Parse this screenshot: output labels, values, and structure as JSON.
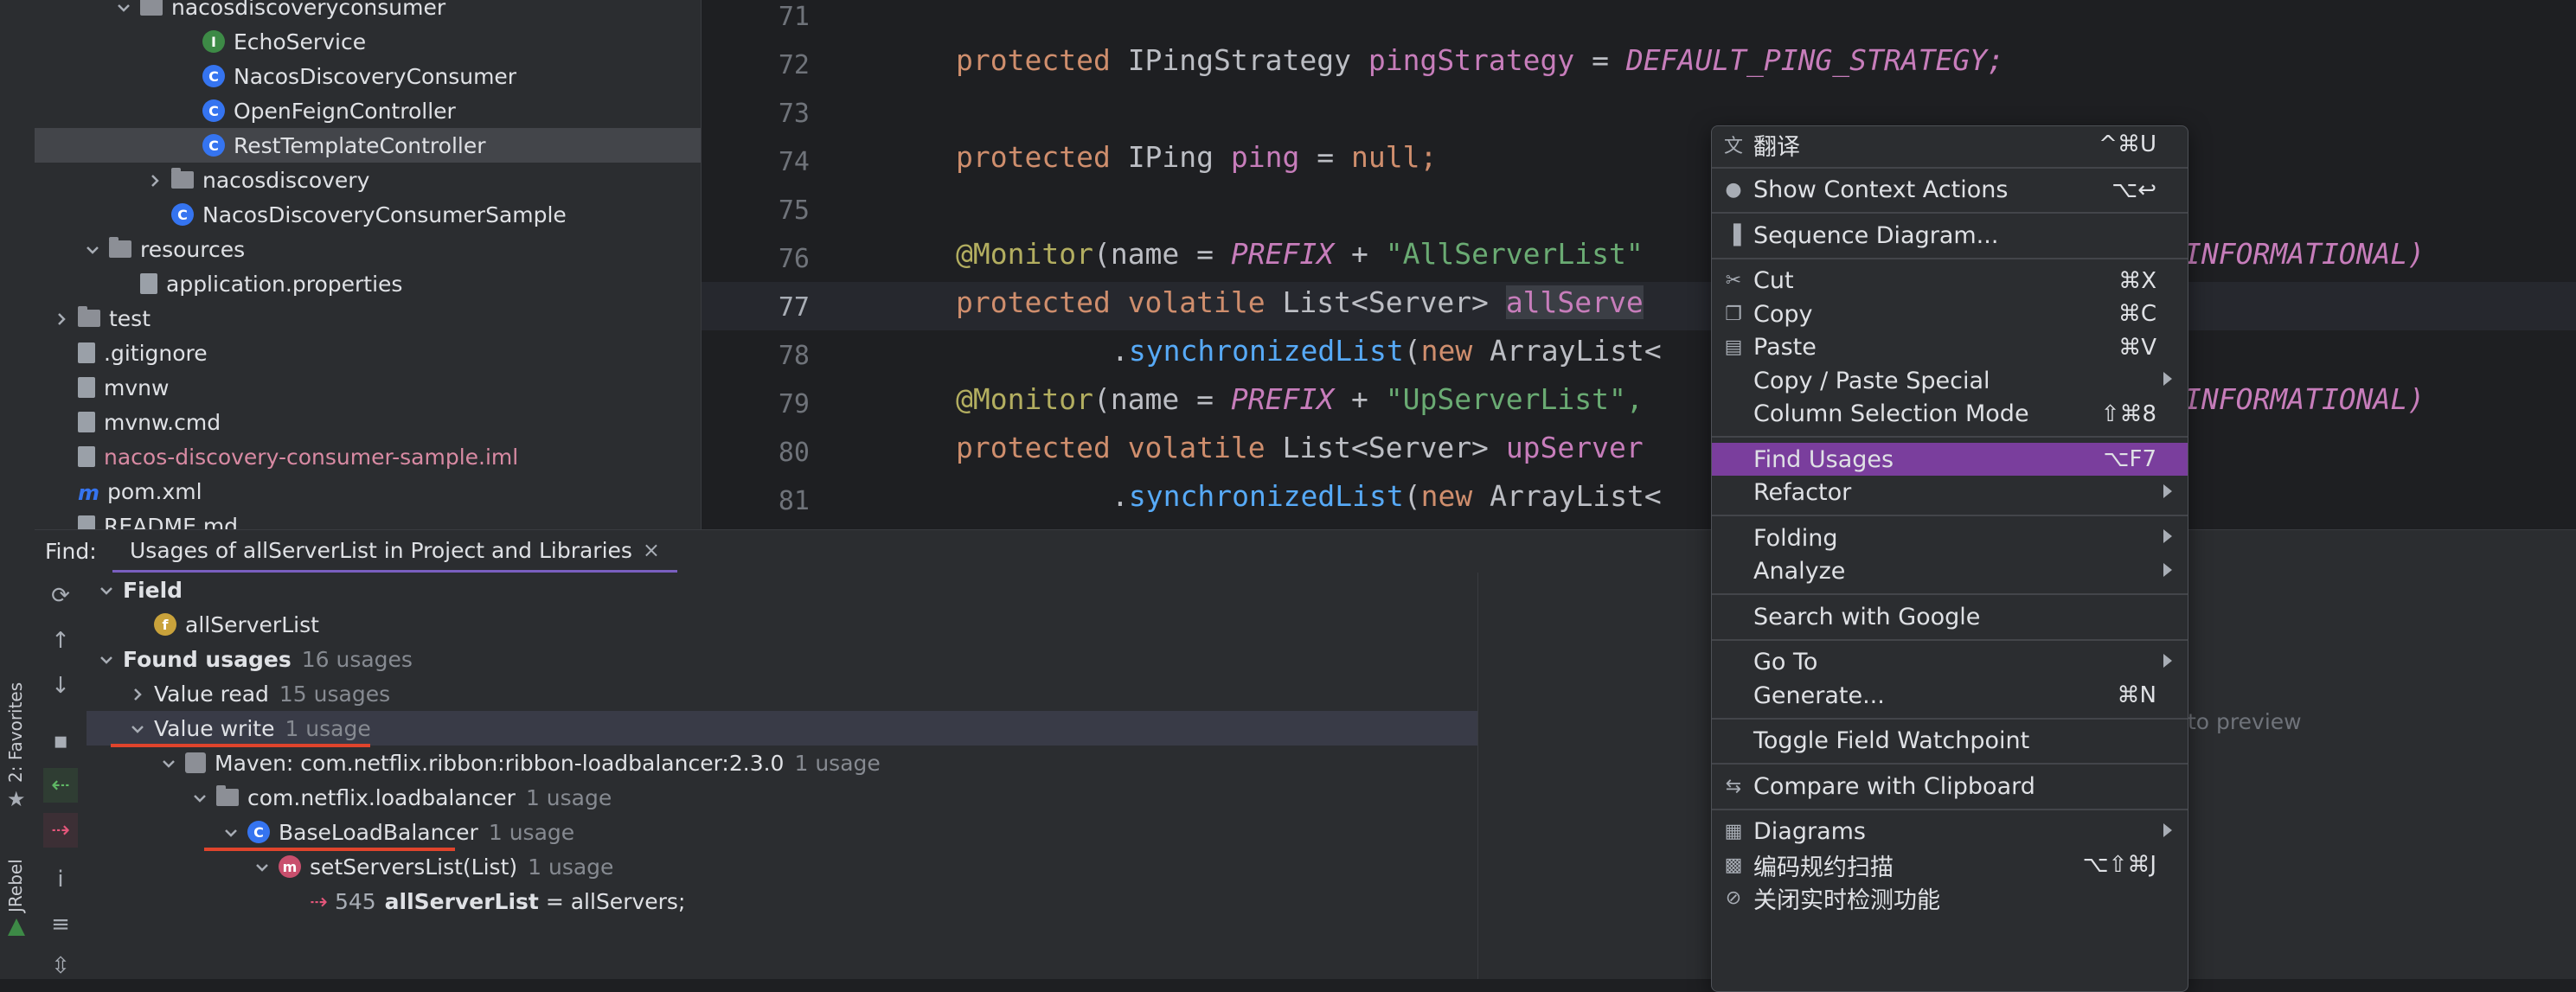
{
  "leftbar": {
    "favorites": "2: Favorites",
    "jrebel": "JRebel"
  },
  "project_tree": [
    {
      "label": "nacosdiscoveryconsumer",
      "kind": "folder",
      "indent": 2,
      "expanded": true
    },
    {
      "label": "EchoService",
      "kind": "interface",
      "indent": 4
    },
    {
      "label": "NacosDiscoveryConsumer",
      "kind": "class",
      "indent": 4
    },
    {
      "label": "OpenFeignController",
      "kind": "class",
      "indent": 4
    },
    {
      "label": "RestTemplateController",
      "kind": "class",
      "indent": 4,
      "selected": true
    },
    {
      "label": "nacosdiscovery",
      "kind": "folder",
      "indent": 3,
      "expanded": false
    },
    {
      "label": "NacosDiscoveryConsumerSample",
      "kind": "class",
      "indent": 3
    },
    {
      "label": "resources",
      "kind": "folder",
      "indent": 1,
      "expanded": true
    },
    {
      "label": "application.properties",
      "kind": "file",
      "indent": 2
    },
    {
      "label": "test",
      "kind": "folder",
      "indent": 0,
      "expanded": false
    },
    {
      "label": ".gitignore",
      "kind": "file",
      "indent": 0
    },
    {
      "label": "mvnw",
      "kind": "file",
      "indent": 0
    },
    {
      "label": "mvnw.cmd",
      "kind": "file",
      "indent": 0
    },
    {
      "label": "nacos-discovery-consumer-sample.iml",
      "kind": "file",
      "indent": 0,
      "accent": "#d88aa3"
    },
    {
      "label": "pom.xml",
      "kind": "maven",
      "indent": 0
    },
    {
      "label": "README.md",
      "kind": "file",
      "indent": 0
    }
  ],
  "editor": {
    "line_numbers": [
      "71",
      "72",
      "73",
      "74",
      "75",
      "76",
      "77",
      "78",
      "79",
      "80",
      "81"
    ],
    "lines": {
      "l72": [
        "protected",
        "IPingStrategy",
        "pingStrategy",
        "=",
        "DEFAULT_PING_STRATEGY;"
      ],
      "l74": [
        "protected",
        "IPing",
        "ping",
        "=",
        "null;"
      ],
      "l76a": "@Monitor",
      "l76b": "(name = ",
      "l76c": "PREFIX",
      "l76d": " + ",
      "l76e": "\"AllServerList\"",
      "l76tail": "INFORMATIONAL)",
      "l77": [
        "protected",
        "volatile",
        "List<Server>",
        "allServe"
      ],
      "l78a": ".",
      "l78b": "synchronizedList",
      "l78c": "(",
      "l78d": "new",
      "l78e": " ArrayList<",
      "l79a": "@Monitor",
      "l79b": "(name = ",
      "l79c": "PREFIX",
      "l79d": " + ",
      "l79e": "\"UpServerList\",",
      "l79tail": "INFORMATIONAL)",
      "l80": [
        "protected",
        "volatile",
        "List<Server>",
        "upServer"
      ],
      "l81a": ".",
      "l81b": "synchronizedList",
      "l81c": "(",
      "l81d": "new",
      "l81e": " ArrayList<"
    }
  },
  "find": {
    "label": "Find:",
    "tab_title": "Usages of allServerList in Project and Libraries",
    "close": "×",
    "preview_hint": "to preview",
    "tree": [
      {
        "label": "Field",
        "count": "",
        "bold": true,
        "depth": 0,
        "chev": "down"
      },
      {
        "label": "allServerList",
        "count": "",
        "depth": 1,
        "chev": "none",
        "icon": "field"
      },
      {
        "label": "Found usages",
        "count": "16 usages",
        "bold": true,
        "depth": 0,
        "chev": "down"
      },
      {
        "label": "Value read",
        "count": "15 usages",
        "depth": 1,
        "chev": "right"
      },
      {
        "label": "Value write",
        "count": "1 usage",
        "depth": 1,
        "chev": "down",
        "selected": true,
        "underline": true
      },
      {
        "label": "Maven: com.netflix.ribbon:ribbon-loadbalancer:2.3.0",
        "count": "1 usage",
        "depth": 2,
        "chev": "down",
        "icon": "lib"
      },
      {
        "label": "com.netflix.loadbalancer",
        "count": "1 usage",
        "depth": 3,
        "chev": "down",
        "icon": "pkg"
      },
      {
        "label": "BaseLoadBalancer",
        "count": "1 usage",
        "depth": 4,
        "chev": "down",
        "icon": "class",
        "underline": true
      },
      {
        "label": "setServersList(List)",
        "count": "1 usage",
        "depth": 5,
        "chev": "down",
        "icon": "method"
      },
      {
        "label": "545",
        "count": "",
        "depth": 6,
        "chev": "none",
        "icon": "write",
        "code": "allServerList",
        "rest": " = allServers;"
      }
    ]
  },
  "context_menu": {
    "items": [
      {
        "type": "item",
        "label": "翻译",
        "shortcut": "^⌘U",
        "icon": "translate-icon",
        "glyph": "文"
      },
      {
        "type": "sep"
      },
      {
        "type": "item",
        "label": "Show Context Actions",
        "shortcut": "⌥↩",
        "icon": "bulb-icon",
        "glyph": "●"
      },
      {
        "type": "sep"
      },
      {
        "type": "item",
        "label": "Sequence Diagram...",
        "shortcut": "",
        "icon": "sequence-diagram-icon",
        "glyph": "▐"
      },
      {
        "type": "sep"
      },
      {
        "type": "item",
        "label": "Cut",
        "shortcut": "⌘X",
        "icon": "scissors-icon",
        "glyph": "✂"
      },
      {
        "type": "item",
        "label": "Copy",
        "shortcut": "⌘C",
        "icon": "copy-icon",
        "glyph": "❐"
      },
      {
        "type": "item",
        "label": "Paste",
        "shortcut": "⌘V",
        "icon": "paste-icon",
        "glyph": "▤"
      },
      {
        "type": "item",
        "label": "Copy / Paste Special",
        "shortcut": "",
        "submenu": true
      },
      {
        "type": "item",
        "label": "Column Selection Mode",
        "shortcut": "⇧⌘8"
      },
      {
        "type": "sep"
      },
      {
        "type": "item",
        "label": "Find Usages",
        "shortcut": "⌥F7",
        "highlight": true
      },
      {
        "type": "item",
        "label": "Refactor",
        "shortcut": "",
        "submenu": true
      },
      {
        "type": "sep"
      },
      {
        "type": "item",
        "label": "Folding",
        "shortcut": "",
        "submenu": true
      },
      {
        "type": "item",
        "label": "Analyze",
        "shortcut": "",
        "submenu": true
      },
      {
        "type": "sep"
      },
      {
        "type": "item",
        "label": "Search with Google",
        "shortcut": ""
      },
      {
        "type": "sep"
      },
      {
        "type": "item",
        "label": "Go To",
        "shortcut": "",
        "submenu": true
      },
      {
        "type": "item",
        "label": "Generate...",
        "shortcut": "⌘N"
      },
      {
        "type": "sep"
      },
      {
        "type": "item",
        "label": "Toggle Field Watchpoint",
        "shortcut": ""
      },
      {
        "type": "sep"
      },
      {
        "type": "item",
        "label": "Compare with Clipboard",
        "shortcut": "",
        "icon": "compare-icon",
        "glyph": "⇆"
      },
      {
        "type": "sep"
      },
      {
        "type": "item",
        "label": "Diagrams",
        "shortcut": "",
        "submenu": true,
        "icon": "diagrams-icon",
        "glyph": "▦"
      },
      {
        "type": "item",
        "label": "编码规约扫描",
        "shortcut": "⌥⇧⌘J",
        "icon": "scan-icon",
        "glyph": "▩"
      },
      {
        "type": "item",
        "label": "关闭实时检测功能",
        "shortcut": "",
        "icon": "disable-icon",
        "glyph": "⊘"
      }
    ]
  },
  "colors": {
    "accent_underline": "#e0442c",
    "menu_highlight": "#7a3e9d",
    "tab_underline": "#7a5fc0"
  }
}
